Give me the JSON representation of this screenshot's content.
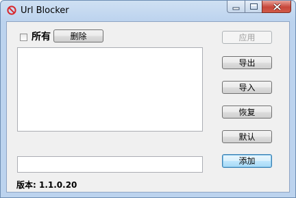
{
  "window": {
    "title": "Url Blocker",
    "icon": "no-entry-icon",
    "controls": [
      "minimize-icon",
      "maximize-icon",
      "close-icon"
    ]
  },
  "toolbar": {
    "select_all_label": "所有",
    "select_all_checked": false,
    "delete_label": "删除"
  },
  "side_buttons": {
    "apply_label": "应用",
    "export_label": "导出",
    "import_label": "导入",
    "restore_label": "恢复",
    "default_label": "默认",
    "add_label": "添加"
  },
  "url_input": {
    "value": ""
  },
  "version": "版本: 1.1.0.20",
  "colors": {
    "frame": "#bcd3ee",
    "client": "#f0f0f0",
    "close": "#c7473a",
    "focus": "#3c7fb1"
  }
}
